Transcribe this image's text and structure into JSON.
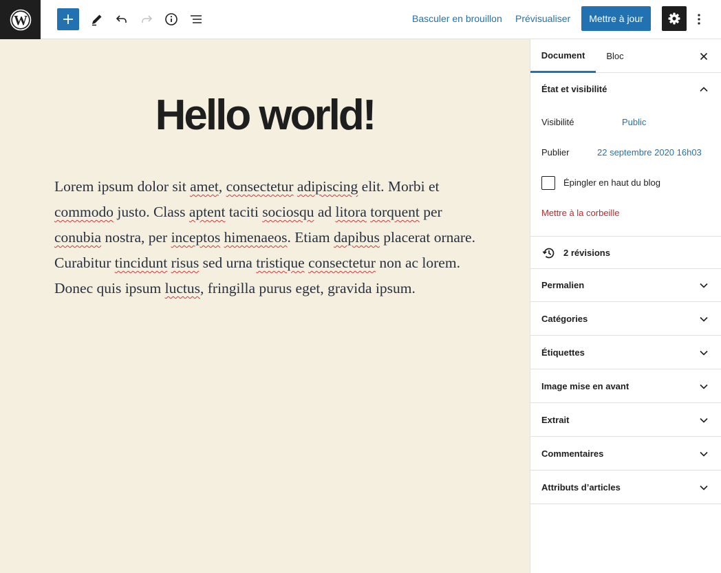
{
  "toolbar": {
    "switch_to_draft": "Basculer en brouillon",
    "preview": "Prévisualiser",
    "update": "Mettre à jour",
    "icons": [
      "wordpress-logo-icon",
      "plus-icon",
      "pencil-icon",
      "undo-icon",
      "redo-icon",
      "info-icon",
      "list-view-icon",
      "gear-icon",
      "more-vertical-icon"
    ]
  },
  "post": {
    "title": "Hello world!",
    "body_segments": [
      {
        "t": "Lorem ipsum dolor sit ",
        "s": false
      },
      {
        "t": "amet",
        "s": true
      },
      {
        "t": ", ",
        "s": false
      },
      {
        "t": "consectetur",
        "s": true
      },
      {
        "t": " ",
        "s": false
      },
      {
        "t": "adipiscing",
        "s": true
      },
      {
        "t": " elit. Morbi et ",
        "s": false
      },
      {
        "t": "commodo",
        "s": true
      },
      {
        "t": " justo. Class ",
        "s": false
      },
      {
        "t": "aptent",
        "s": true
      },
      {
        "t": " taciti ",
        "s": false
      },
      {
        "t": "sociosqu",
        "s": true
      },
      {
        "t": " ad ",
        "s": false
      },
      {
        "t": "litora",
        "s": true
      },
      {
        "t": " ",
        "s": false
      },
      {
        "t": "torquent",
        "s": true
      },
      {
        "t": " per ",
        "s": false
      },
      {
        "t": "conubia",
        "s": true
      },
      {
        "t": " nostra, per ",
        "s": false
      },
      {
        "t": "inceptos",
        "s": true
      },
      {
        "t": " ",
        "s": false
      },
      {
        "t": "himenaeos",
        "s": true
      },
      {
        "t": ". Etiam ",
        "s": false
      },
      {
        "t": "dapibus",
        "s": true
      },
      {
        "t": " placerat ornare. Curabitur ",
        "s": false
      },
      {
        "t": "tincidunt",
        "s": true
      },
      {
        "t": " ",
        "s": false
      },
      {
        "t": "risus",
        "s": true
      },
      {
        "t": " sed urna ",
        "s": false
      },
      {
        "t": "tristique",
        "s": true
      },
      {
        "t": " ",
        "s": false
      },
      {
        "t": "consectetur",
        "s": true
      },
      {
        "t": " non ac lorem. Donec quis ipsum ",
        "s": false
      },
      {
        "t": "luctus",
        "s": true
      },
      {
        "t": ", fringilla purus eget, gravida ipsum.",
        "s": false
      }
    ]
  },
  "sidebar": {
    "tabs": [
      {
        "label": "Document",
        "active": true
      },
      {
        "label": "Bloc",
        "active": false
      }
    ],
    "status_panel": {
      "title": "État et visibilité",
      "visibility_label": "Visibilité",
      "visibility_value": "Public",
      "publish_label": "Publier",
      "publish_value": "22 septembre 2020 16h03",
      "sticky_label": "Épingler en haut du blog",
      "sticky_checked": false,
      "trash_label": "Mettre à la corbeille"
    },
    "revisions": "2 révisions",
    "panels": [
      "Permalien",
      "Catégories",
      "Étiquettes",
      "Image mise en avant",
      "Extrait",
      "Commentaires",
      "Attributs d’articles"
    ]
  },
  "colors": {
    "accent": "#2271b1",
    "canvas_bg": "#f5efe0",
    "danger": "#b32d2e",
    "dark": "#1e1e1e"
  }
}
